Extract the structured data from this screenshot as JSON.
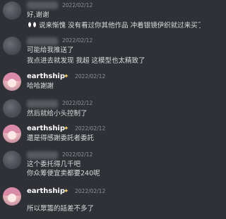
{
  "messages": [
    {
      "author": "",
      "avatar": "blurred-avatar",
      "timestamp": "2022/02/12",
      "lines": [
        "好,谢谢",
        "说来惭愧 没有看过你其他作品 冲着银镜伊织就过来买了("
      ],
      "inline_icon": "eyes-emoji"
    },
    {
      "author": "",
      "avatar": "blurred-avatar",
      "timestamp": "2022/02/12",
      "lines": [
        "可能给我推送了",
        "我点进去就发现 我超 这模型也太精致了"
      ]
    },
    {
      "author": "earthship",
      "avatar": "anime-avatar",
      "badge": "sparkle",
      "timestamp": "2022/02/12",
      "lines": [
        "哈哈謝謝"
      ]
    },
    {
      "author": "",
      "avatar": "blurred-avatar",
      "timestamp": "2022/02/12",
      "lines": [
        "然后就给小头控制了"
      ]
    },
    {
      "author": "earthship",
      "avatar": "anime-avatar",
      "badge": "sparkle",
      "timestamp": "2022/02/12",
      "lines": [
        "還是得感謝委託者委託"
      ]
    },
    {
      "author": "",
      "avatar": "blurred-avatar",
      "timestamp": "2022/02/12",
      "lines": [
        "这个委托得几千吧",
        "你众筹便宜卖都要240呢"
      ]
    },
    {
      "author": "earthship",
      "avatar": "anime-avatar",
      "badge": "sparkle",
      "timestamp": "2022/02/12",
      "lines": [
        "所以眾籌的話差不多了"
      ]
    }
  ],
  "colors": {
    "background": "#2f3136",
    "text": "#dcddde",
    "username": "#ffffff",
    "timestamp": "#8e9297",
    "badge": "#f6d26b"
  }
}
